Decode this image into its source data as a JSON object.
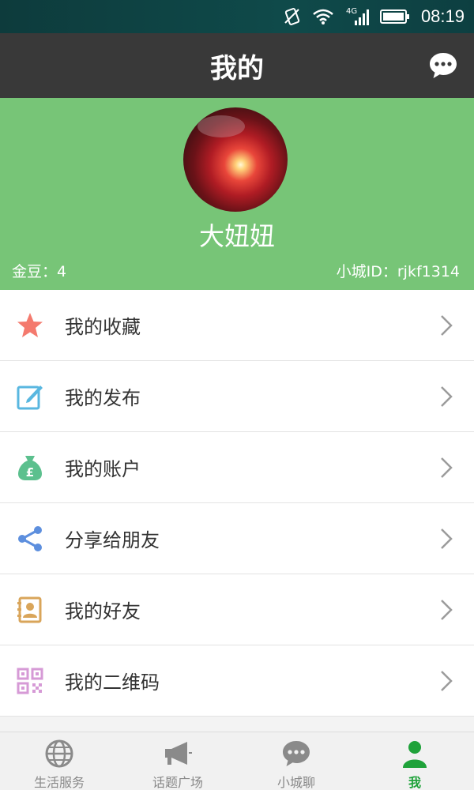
{
  "status": {
    "time": "08:19",
    "network": "4G"
  },
  "header": {
    "title": "我的"
  },
  "profile": {
    "nickname": "大妞妞",
    "coins_text": "金豆：4",
    "city_id_text": "小城ID：rjkf1314"
  },
  "menu": [
    {
      "label": "我的收藏",
      "icon": "star-icon",
      "color": "#f47a6e"
    },
    {
      "label": "我的发布",
      "icon": "edit-icon",
      "color": "#59b7e0"
    },
    {
      "label": "我的账户",
      "icon": "money-bag-icon",
      "color": "#5cc08e"
    },
    {
      "label": "分享给朋友",
      "icon": "share-icon",
      "color": "#5d8fde"
    },
    {
      "label": "我的好友",
      "icon": "contacts-icon",
      "color": "#d9a55a"
    },
    {
      "label": "我的二维码",
      "icon": "qrcode-icon",
      "color": "#d69ad6"
    }
  ],
  "tabs": [
    {
      "label": "生活服务",
      "icon": "globe-icon",
      "active": false
    },
    {
      "label": "话题广场",
      "icon": "megaphone-icon",
      "active": false
    },
    {
      "label": "小城聊",
      "icon": "chat-icon",
      "active": false
    },
    {
      "label": "我",
      "icon": "person-icon",
      "active": true
    }
  ],
  "colors": {
    "accent": "#77c577",
    "active_tab": "#1fa23a",
    "title_bar": "#393939"
  }
}
